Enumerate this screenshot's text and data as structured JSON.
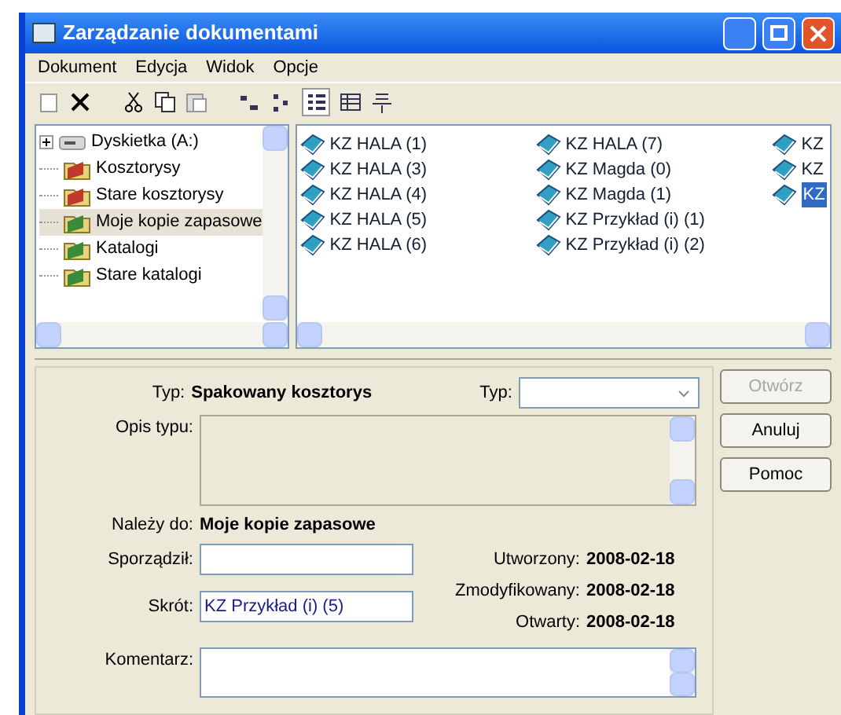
{
  "window": {
    "title": "Zarządzanie dokumentami"
  },
  "menu": [
    "Dokument",
    "Edycja",
    "Widok",
    "Opcje"
  ],
  "tree": [
    {
      "label": "Dyskietka (A:)",
      "kind": "drive",
      "color": "#9a9a9a",
      "selected": false
    },
    {
      "label": "Kosztorysy",
      "kind": "folder",
      "color": "#c0392b",
      "selected": false
    },
    {
      "label": "Stare kosztorysy",
      "kind": "folder",
      "color": "#c0392b",
      "selected": false
    },
    {
      "label": "Moje kopie zapasowe",
      "kind": "folder",
      "color": "#3a8a3a",
      "selected": true
    },
    {
      "label": "Katalogi",
      "kind": "folder",
      "color": "#3a8a3a",
      "selected": false
    },
    {
      "label": "Stare katalogi",
      "kind": "folder",
      "color": "#3a8a3a",
      "selected": false
    }
  ],
  "files": [
    [
      {
        "label": "KZ  HALA (1)",
        "selected": false
      },
      {
        "label": "KZ  HALA (3)",
        "selected": false
      },
      {
        "label": "KZ  HALA (4)",
        "selected": false
      },
      {
        "label": "KZ  HALA (5)",
        "selected": false
      },
      {
        "label": "KZ  HALA (6)",
        "selected": false
      }
    ],
    [
      {
        "label": "KZ  HALA (7)",
        "selected": false
      },
      {
        "label": "KZ  Magda (0)",
        "selected": false
      },
      {
        "label": "KZ  Magda (1)",
        "selected": false
      },
      {
        "label": "KZ  Przykład (i) (1)",
        "selected": false
      },
      {
        "label": "KZ  Przykład (i) (2)",
        "selected": false
      }
    ],
    [
      {
        "label": "KZ",
        "selected": false
      },
      {
        "label": "KZ",
        "selected": false
      },
      {
        "label": "KZ",
        "selected": true
      }
    ]
  ],
  "form": {
    "type": {
      "label": "Typ:",
      "value": "Spakowany kosztorys"
    },
    "type_filter": {
      "label": "Typ:"
    },
    "description": {
      "label": "Opis typu:"
    },
    "owner": {
      "label": "Należy do:",
      "value": "Moje kopie zapasowe"
    },
    "author": {
      "label": "Sporządził:"
    },
    "shortcut": {
      "label": "Skrót:",
      "value": "KZ  Przykład (i) (5)"
    },
    "dates": [
      {
        "label": "Utworzony:",
        "value": "2008-02-18"
      },
      {
        "label": "Zmodyfikowany:",
        "value": "2008-02-18"
      },
      {
        "label": "Otwarty:",
        "value": "2008-02-18"
      }
    ],
    "comment": {
      "label": "Komentarz:"
    }
  },
  "buttons": [
    {
      "label": "Otwórz",
      "disabled": true
    },
    {
      "label": "Anuluj",
      "disabled": false
    },
    {
      "label": "Pomoc",
      "disabled": false
    }
  ]
}
